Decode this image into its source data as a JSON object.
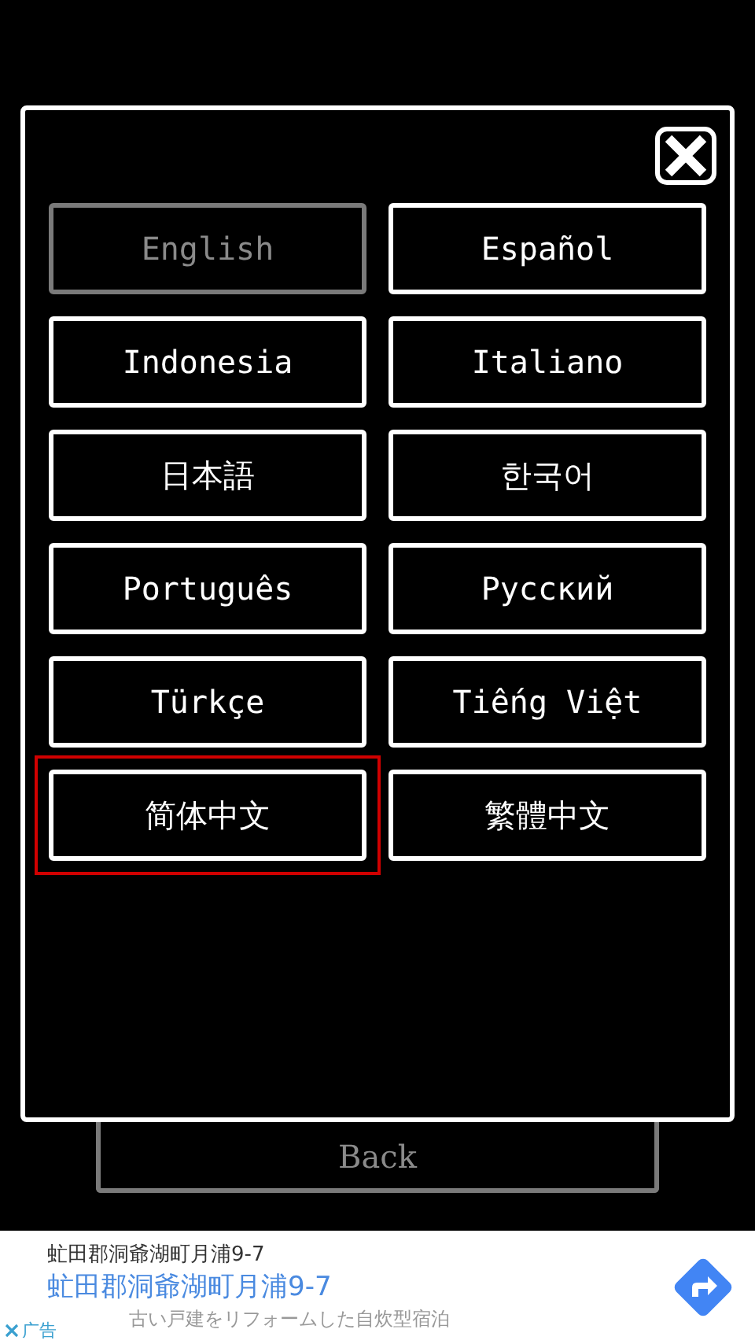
{
  "dialog": {
    "languages": [
      {
        "label": "English",
        "disabled": true,
        "selected": false
      },
      {
        "label": "Español",
        "disabled": false,
        "selected": false
      },
      {
        "label": "Indonesia",
        "disabled": false,
        "selected": false
      },
      {
        "label": "Italiano",
        "disabled": false,
        "selected": false
      },
      {
        "label": "日本語",
        "disabled": false,
        "selected": false
      },
      {
        "label": "한국어",
        "disabled": false,
        "selected": false
      },
      {
        "label": "Português",
        "disabled": false,
        "selected": false
      },
      {
        "label": "Русский",
        "disabled": false,
        "selected": false
      },
      {
        "label": "Türkçe",
        "disabled": false,
        "selected": false
      },
      {
        "label": "Tiếng Việt",
        "disabled": false,
        "selected": false
      },
      {
        "label": "简体中文",
        "disabled": false,
        "selected": true
      },
      {
        "label": "繁體中文",
        "disabled": false,
        "selected": false
      }
    ]
  },
  "back_button": {
    "label": "Back",
    "disabled": true
  },
  "ad_banner": {
    "lines": [
      {
        "text": "虻田郡洞爺湖町月浦9-7",
        "kind": "title"
      },
      {
        "text": "虻田郡洞爺湖町月浦9-7",
        "kind": "link"
      },
      {
        "text": "古い戸建をリフォームした自炊型宿泊",
        "kind": "body"
      }
    ],
    "ad_label": "广告"
  }
}
